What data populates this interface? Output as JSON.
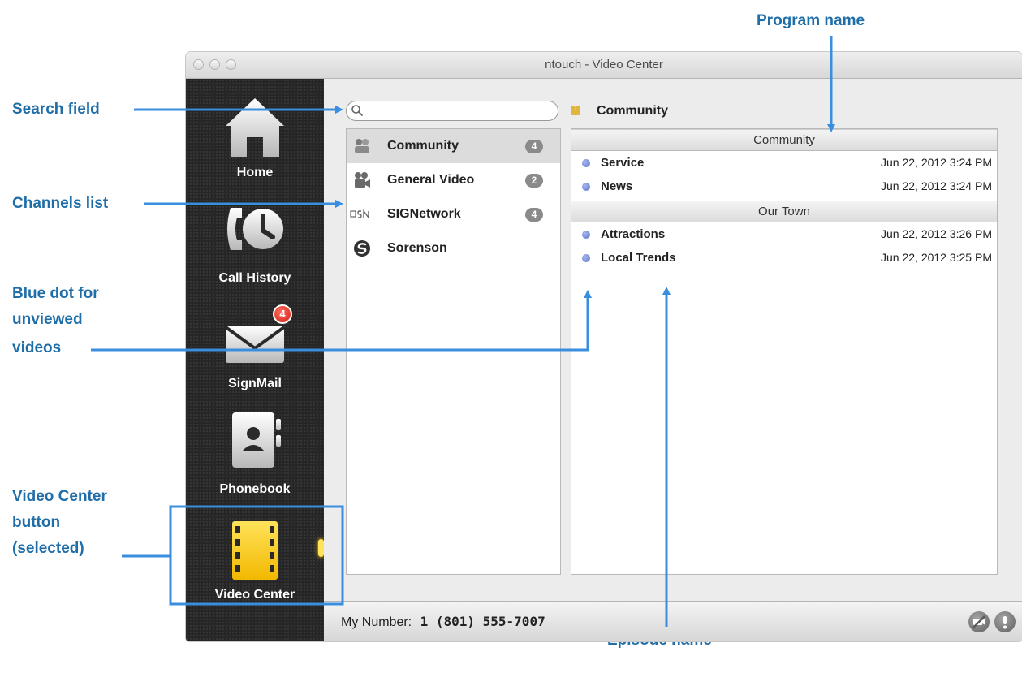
{
  "window": {
    "title": "ntouch - Video Center"
  },
  "nav": {
    "items": [
      {
        "label": "Home",
        "icon": "home-icon"
      },
      {
        "label": "Call History",
        "icon": "call-history-icon"
      },
      {
        "label": "SignMail",
        "icon": "mail-icon",
        "badge": "4"
      },
      {
        "label": "Phonebook",
        "icon": "phonebook-icon"
      },
      {
        "label": "Video Center",
        "icon": "film-icon",
        "selected": true
      }
    ]
  },
  "search": {
    "placeholder": "",
    "value": ""
  },
  "channels": [
    {
      "name": "Community",
      "count": "4",
      "selected": true
    },
    {
      "name": "General Video",
      "count": "2"
    },
    {
      "name": "SIGNetwork",
      "count": "4"
    },
    {
      "name": "Sorenson",
      "count": ""
    }
  ],
  "program_header": {
    "title": "Community"
  },
  "programs": [
    {
      "name": "Community",
      "episodes": [
        {
          "title": "Service",
          "date": "Jun 22, 2012 3:24 PM",
          "unviewed": true
        },
        {
          "title": "News",
          "date": "Jun 22, 2012 3:24 PM",
          "unviewed": true
        }
      ]
    },
    {
      "name": "Our Town",
      "episodes": [
        {
          "title": "Attractions",
          "date": "Jun 22, 2012 3:26 PM",
          "unviewed": true
        },
        {
          "title": "Local Trends",
          "date": "Jun 22, 2012 3:25 PM",
          "unviewed": true
        }
      ]
    }
  ],
  "footer": {
    "my_number_label": "My Number:",
    "my_number": "1 (801) 555-7007"
  },
  "annotations": {
    "search_field": "Search field",
    "channels_list": "Channels list",
    "blue_dot_1": "Blue dot for",
    "blue_dot_2": "unviewed",
    "blue_dot_3": "videos",
    "video_center_1": "Video Center",
    "video_center_2": "button",
    "video_center_3": "(selected)",
    "program_name": "Program name",
    "episode_name": "Episode name"
  },
  "colors": {
    "annotation": "#1f6ea8",
    "arrow": "#3a8ee0",
    "selected_nav": "#f6c600",
    "unviewed_dot": "#6b7fd6"
  }
}
